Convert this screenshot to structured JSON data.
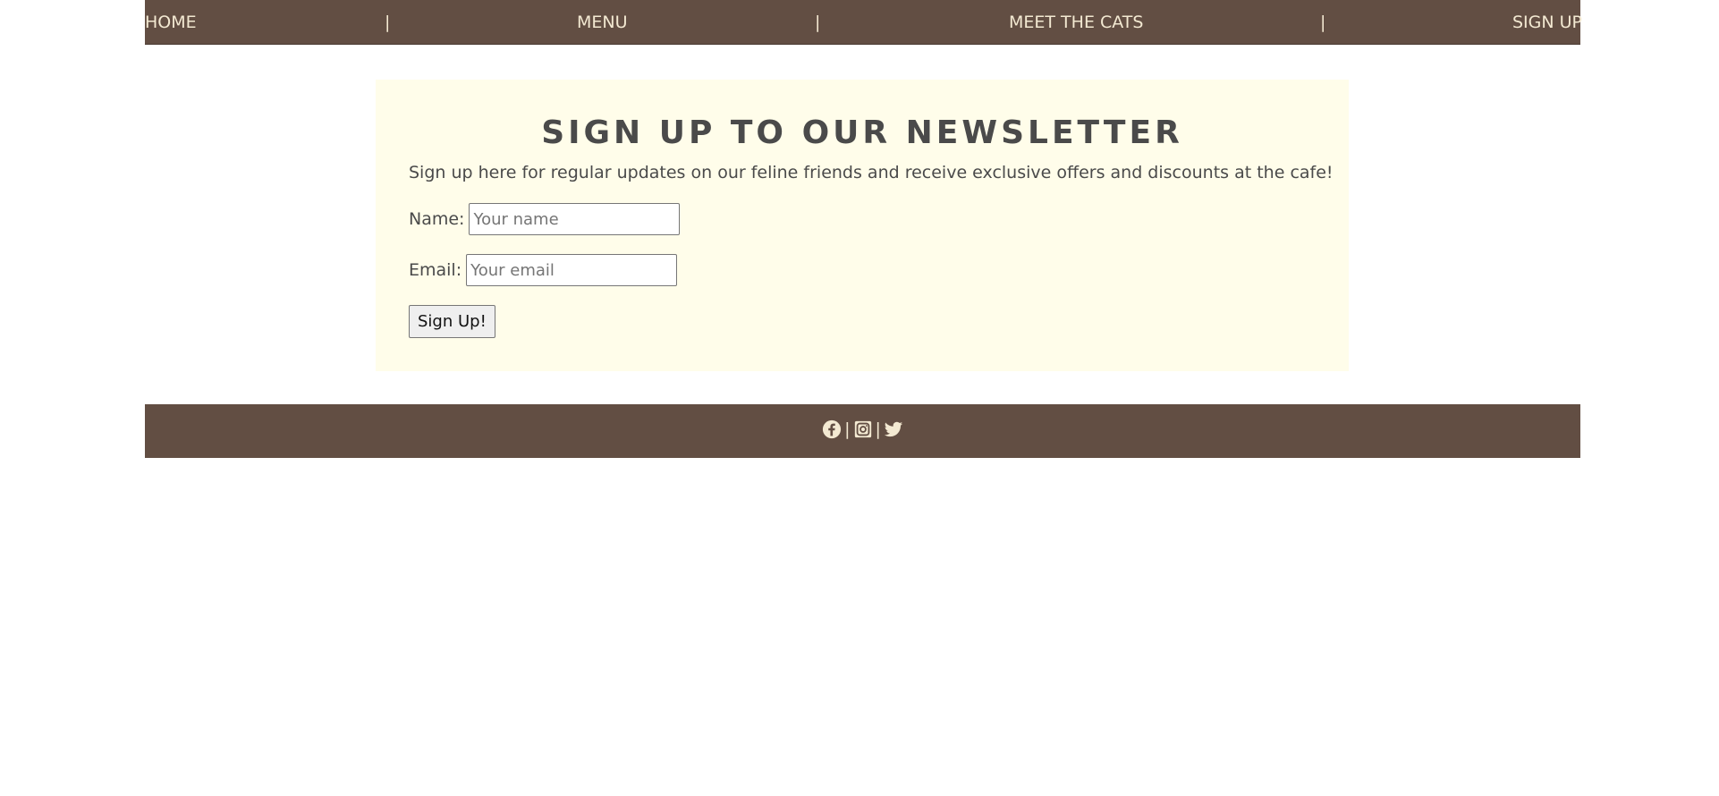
{
  "nav": {
    "home": "HOME",
    "menu": "MENU",
    "meet_the_cats": "MEET THE CATS",
    "sign_up": "SIGN UP",
    "separator": "|"
  },
  "newsletter": {
    "title": "SIGN UP TO OUR NEWSLETTER",
    "intro": "Sign up here for regular updates on our feline friends and receive exclusive offers and discounts at the cafe!",
    "name_label": "Name:",
    "name_placeholder": "Your name",
    "email_label": "Email:",
    "email_placeholder": "Your email",
    "submit_label": "Sign Up!"
  },
  "footer": {
    "separator": "|",
    "icons": [
      "facebook-icon",
      "instagram-icon",
      "twitter-icon"
    ]
  },
  "colors": {
    "bar_brown": "#624e43",
    "bar_text": "#f3e9d2",
    "panel_cream": "#fffdea",
    "body_text": "#4a4a4a"
  }
}
